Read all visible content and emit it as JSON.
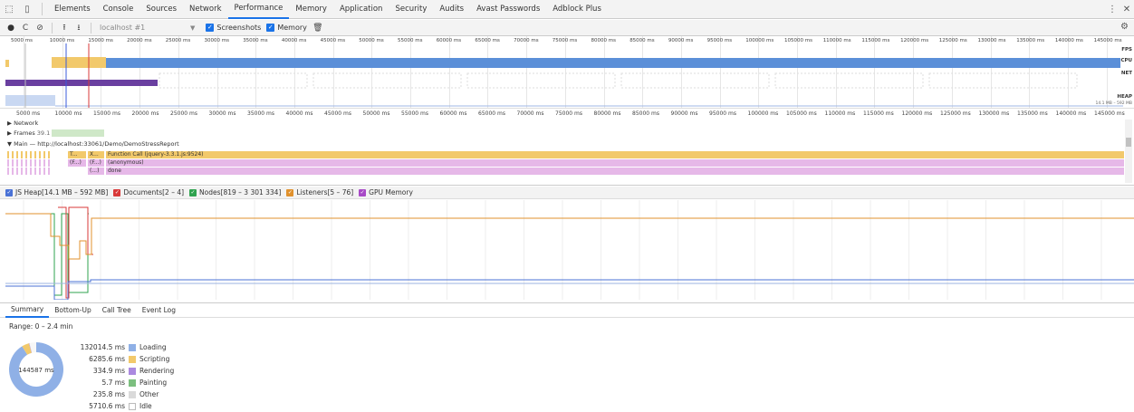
{
  "tabs": [
    "Elements",
    "Console",
    "Sources",
    "Network",
    "Performance",
    "Memory",
    "Application",
    "Security",
    "Audits",
    "Avast Passwords",
    "Adblock Plus"
  ],
  "active_tab": "Performance",
  "toolbar": {
    "profile": "localhost #1",
    "screenshots_label": "Screenshots",
    "memory_label": "Memory"
  },
  "overview": {
    "ruler_top": [
      "5000 ms",
      "10000 ms",
      "15000 ms",
      "20000 ms",
      "25000 ms",
      "30000 ms",
      "35000 ms",
      "40000 ms",
      "45000 ms",
      "50000 ms",
      "55000 ms",
      "60000 ms",
      "65000 ms",
      "70000 ms",
      "75000 ms",
      "80000 ms",
      "85000 ms",
      "90000 ms",
      "95000 ms",
      "100000 ms",
      "105000 ms",
      "110000 ms",
      "115000 ms",
      "120000 ms",
      "125000 ms",
      "130000 ms",
      "135000 ms",
      "140000 ms",
      "145000 ms"
    ],
    "labels": {
      "fps": "FPS",
      "cpu": "CPU",
      "net": "NET",
      "heap": "HEAP",
      "heap_range": "14.1 MB – 592 MB"
    }
  },
  "flame": {
    "ruler": [
      "5000 ms",
      "10000 ms",
      "15000 ms",
      "20000 ms",
      "25000 ms",
      "30000 ms",
      "35000 ms",
      "40000 ms",
      "45000 ms",
      "50000 ms",
      "55000 ms",
      "60000 ms",
      "65000 ms",
      "70000 ms",
      "75000 ms",
      "80000 ms",
      "85000 ms",
      "90000 ms",
      "95000 ms",
      "100000 ms",
      "105000 ms",
      "110000 ms",
      "115000 ms",
      "120000 ms",
      "125000 ms",
      "130000 ms",
      "135000 ms",
      "140000 ms",
      "145000 ms"
    ],
    "network_label": "Network",
    "frames_label": "Frames",
    "frames_value": "39.1 ms",
    "main_label": "Main — http://localhost:33061/Demo/DemoStressReport",
    "rows": [
      {
        "short1": "T...",
        "short2": "X...",
        "text": "Function Call (jquery-3.3.1.js:9524)"
      },
      {
        "short1": "(F...)",
        "short2": "(F...)",
        "text": "(anonymous)"
      },
      {
        "short1": "",
        "short2": "(...)",
        "text": "done"
      }
    ]
  },
  "counters": [
    {
      "label": "JS Heap[14.1 MB – 592 MB]",
      "color": "#4a72d6"
    },
    {
      "label": "Documents[2 – 4]",
      "color": "#d93a3a"
    },
    {
      "label": "Nodes[819 – 3 301 334]",
      "color": "#2fa34f"
    },
    {
      "label": "Listeners[5 – 76]",
      "color": "#e0912d"
    },
    {
      "label": "GPU Memory",
      "color": "#a84ac7"
    }
  ],
  "bottom_tabs": [
    "Summary",
    "Bottom-Up",
    "Call Tree",
    "Event Log"
  ],
  "summary": {
    "range": "Range: 0 – 2.4 min",
    "total": "144587 ms",
    "items": [
      {
        "value": "132014.5 ms",
        "label": "Loading",
        "color": "#8fb0e6"
      },
      {
        "value": "6285.6 ms",
        "label": "Scripting",
        "color": "#f2c96b"
      },
      {
        "value": "334.9 ms",
        "label": "Rendering",
        "color": "#ab89e0"
      },
      {
        "value": "5.7 ms",
        "label": "Painting",
        "color": "#7cbf7f"
      },
      {
        "value": "235.8 ms",
        "label": "Other",
        "color": "#dadada"
      },
      {
        "value": "5710.6 ms",
        "label": "Idle",
        "color": "#ffffff"
      }
    ]
  }
}
